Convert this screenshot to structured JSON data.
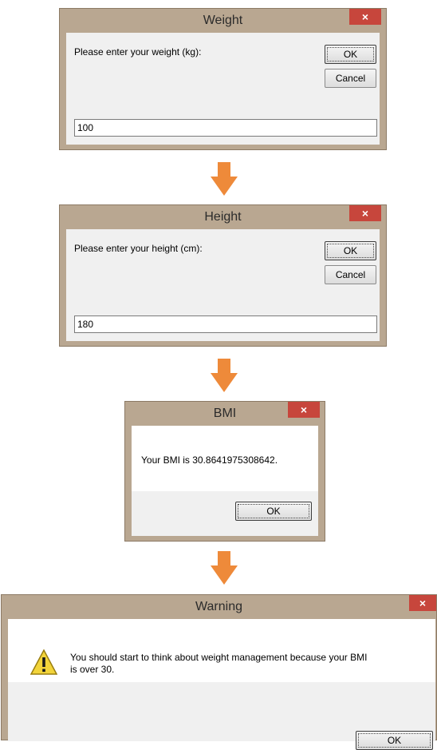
{
  "weight_dialog": {
    "title": "Weight",
    "prompt": "Please enter your weight (kg):",
    "ok": "OK",
    "cancel": "Cancel",
    "value": "100",
    "close": "×"
  },
  "height_dialog": {
    "title": "Height",
    "prompt": "Please enter your height (cm):",
    "ok": "OK",
    "cancel": "Cancel",
    "value": "180",
    "close": "×"
  },
  "bmi_dialog": {
    "title": "BMI",
    "message": "Your BMI is 30.8641975308642.",
    "ok": "OK",
    "close": "×"
  },
  "warning_dialog": {
    "title": "Warning",
    "message_line1": "You should start to think about weight management because your BMI",
    "message_line2": "is over 30.",
    "ok": "OK",
    "close": "×"
  },
  "colors": {
    "arrow": "#ee8a3a",
    "frame": "#b9a791",
    "close": "#c7463c"
  }
}
